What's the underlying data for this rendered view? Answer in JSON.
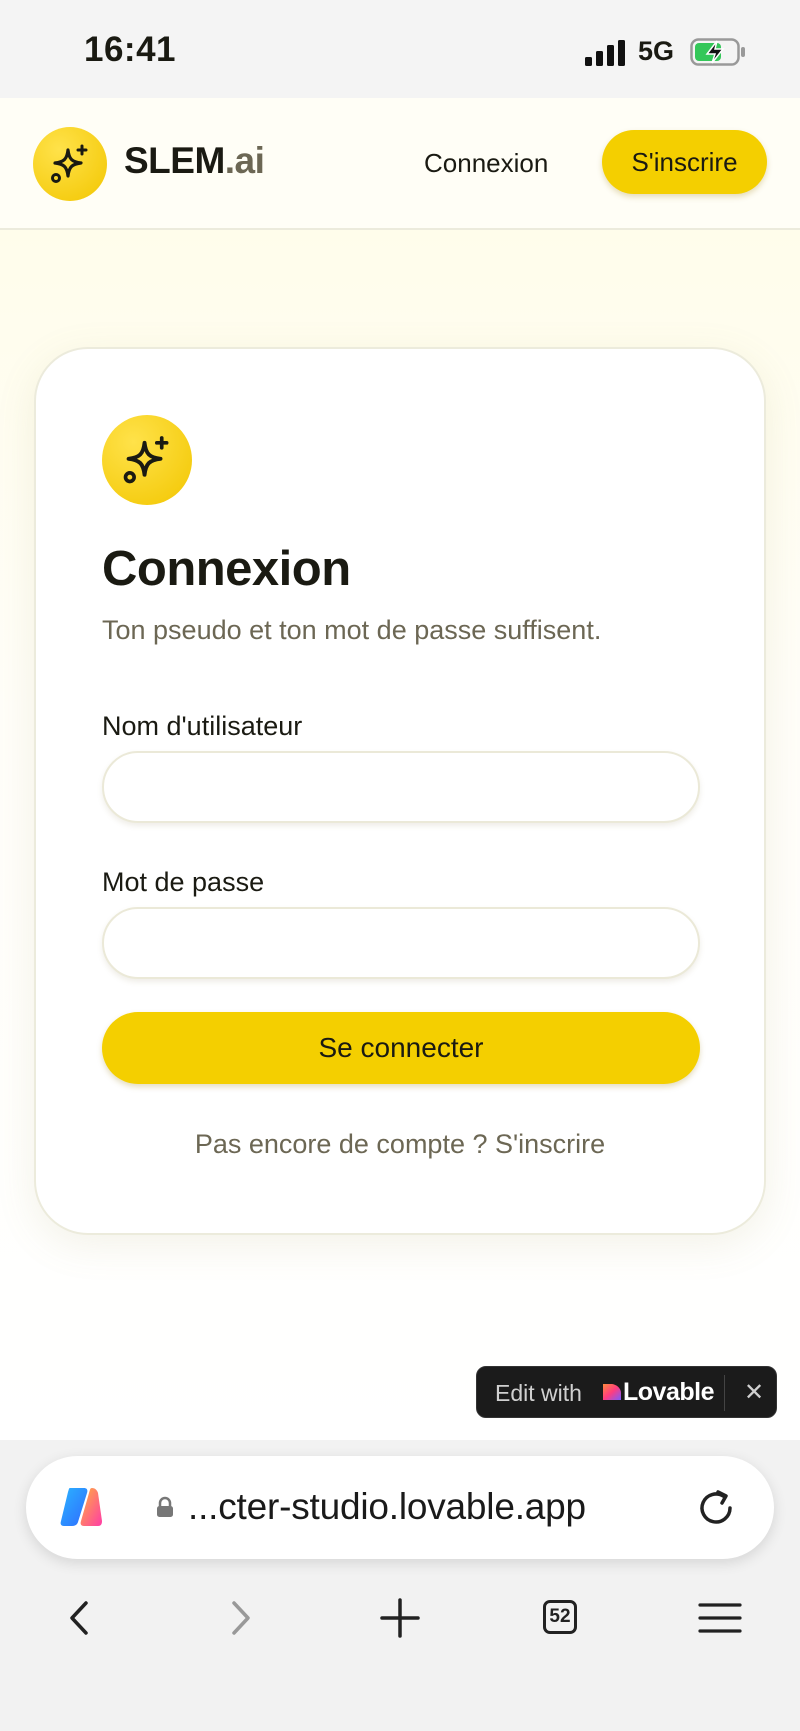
{
  "status_bar": {
    "time": "16:41",
    "network": "5G",
    "icons": [
      "signal-icon",
      "battery-charging-icon"
    ]
  },
  "header": {
    "brand_main": "SLEM",
    "brand_suffix": ".ai",
    "login_link": "Connexion",
    "signup_button": "S'inscrire",
    "logo_icon": "sparkles-icon"
  },
  "login_card": {
    "icon": "sparkles-icon",
    "title": "Connexion",
    "subtitle": "Ton pseudo et ton mot de passe suffisent.",
    "username_label": "Nom d'utilisateur",
    "username_value": "",
    "password_label": "Mot de passe",
    "password_value": "",
    "submit_label": "Se connecter",
    "footer_link": "Pas encore de compte ? S'inscrire"
  },
  "lovable_badge": {
    "text": "Edit with",
    "brand": "Lovable",
    "close_label": "✕"
  },
  "browser": {
    "url": "...cter-studio.lovable.app",
    "tabs_count": "52",
    "icons": [
      "copilot-icon",
      "lock-icon",
      "reload-icon",
      "back-icon",
      "forward-icon",
      "new-tab-icon",
      "tabs-icon",
      "menu-icon"
    ]
  },
  "colors": {
    "accent_yellow": "#f4cf00",
    "text_dark": "#1a1a12",
    "text_muted": "#6c6754",
    "page_background": "#fffdeb"
  }
}
